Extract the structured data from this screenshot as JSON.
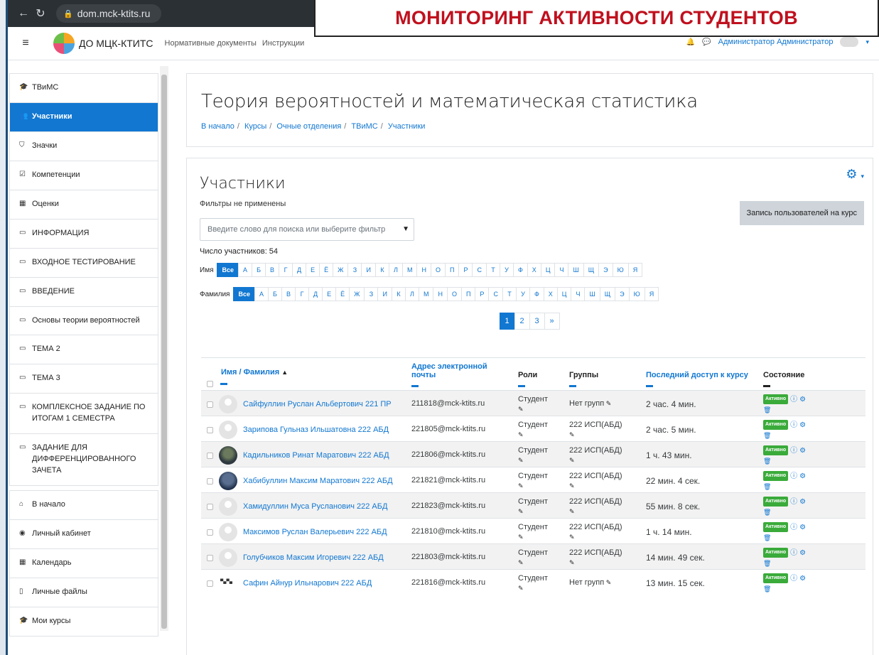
{
  "banner": {
    "title": "МОНИТОРИНГ АКТИВНОСТИ СТУДЕНТОВ"
  },
  "browser": {
    "url": "dom.mck-ktits.ru"
  },
  "navbar": {
    "site_name": "ДО МЦК-КТИТС",
    "links": [
      "Нормативные документы",
      "Инструкции"
    ],
    "user": "Администратор Администратор"
  },
  "sidebar": {
    "course_items": [
      {
        "icon": "graduation-cap-icon",
        "glyph": "🎓",
        "label": "ТВиМС"
      },
      {
        "icon": "users-icon",
        "glyph": "👥",
        "label": "Участники",
        "active": true
      },
      {
        "icon": "shield-icon",
        "glyph": "⛉",
        "label": "Значки"
      },
      {
        "icon": "check-square-icon",
        "glyph": "☑",
        "label": "Компетенции"
      },
      {
        "icon": "table-icon",
        "glyph": "▦",
        "label": "Оценки"
      },
      {
        "icon": "folder-icon",
        "glyph": "▭",
        "label": "ИНФОРМАЦИЯ"
      },
      {
        "icon": "folder-icon",
        "glyph": "▭",
        "label": "ВХОДНОЕ ТЕСТИРОВАНИЕ"
      },
      {
        "icon": "folder-icon",
        "glyph": "▭",
        "label": "ВВЕДЕНИЕ"
      },
      {
        "icon": "folder-icon",
        "glyph": "▭",
        "label": "Основы теории вероятностей"
      },
      {
        "icon": "folder-icon",
        "glyph": "▭",
        "label": "ТЕМА 2"
      },
      {
        "icon": "folder-icon",
        "glyph": "▭",
        "label": "ТЕМА 3"
      },
      {
        "icon": "folder-icon",
        "glyph": "▭",
        "label": "КОМПЛЕКСНОЕ ЗАДАНИЕ ПО ИТОГАМ 1 СЕМЕСТРА"
      },
      {
        "icon": "folder-icon",
        "glyph": "▭",
        "label": "ЗАДАНИЕ ДЛЯ ДИФФЕРЕНЦИРОВАННОГО ЗАЧЕТА"
      }
    ],
    "site_items": [
      {
        "icon": "home-icon",
        "glyph": "⌂",
        "label": "В начало"
      },
      {
        "icon": "dashboard-icon",
        "glyph": "◉",
        "label": "Личный кабинет"
      },
      {
        "icon": "calendar-icon",
        "glyph": "▦",
        "label": "Календарь"
      },
      {
        "icon": "file-icon",
        "glyph": "▯",
        "label": "Личные файлы"
      },
      {
        "icon": "graduation-cap-icon",
        "glyph": "🎓",
        "label": "Мои курсы"
      }
    ]
  },
  "header": {
    "title": "Теория вероятностей и математическая статистика",
    "breadcrumb": [
      "В начало",
      "Курсы",
      "Очные отделения",
      "ТВиМС",
      "Участники"
    ]
  },
  "participants": {
    "title": "Участники",
    "filters_note": "Фильтры не применены",
    "enrol_button": "Запись пользователей на курс",
    "search_placeholder": "Введите слово для поиска или выберите фильтр",
    "count": "Число участников: 54",
    "first_name_label": "Имя",
    "last_name_label": "Фамилия",
    "all_label": "Все",
    "letters": [
      "А",
      "Б",
      "В",
      "Г",
      "Д",
      "Е",
      "Ё",
      "Ж",
      "З",
      "И",
      "К",
      "Л",
      "М",
      "Н",
      "О",
      "П",
      "Р",
      "С",
      "Т",
      "У",
      "Ф",
      "Х",
      "Ц",
      "Ч",
      "Ш",
      "Щ",
      "Э",
      "Ю",
      "Я"
    ],
    "pages": [
      "1",
      "2",
      "3",
      "»"
    ],
    "columns": {
      "name": "Имя / Фамилия",
      "email": "Адрес электронной почты",
      "roles": "Роли",
      "groups": "Группы",
      "last_access": "Последний доступ к курсу",
      "status": "Состояние"
    },
    "status_badge": "Активно",
    "rows": [
      {
        "name": "Сайфуллин Руслан Альбертович 221 ПР",
        "avatar": "default",
        "email": "211818@mck-ktits.ru",
        "role": "Студент",
        "group": "Нет групп",
        "access": "2 час. 4 мин."
      },
      {
        "name": "Зарипова Гульназ Ильшатовна 222 АБД",
        "avatar": "default",
        "email": "221805@mck-ktits.ru",
        "role": "Студент",
        "group": "222 ИСП(АБД)",
        "access": "2 час. 5 мин."
      },
      {
        "name": "Кадильников Ринат Маратович 222 АБД",
        "avatar": "photo",
        "email": "221806@mck-ktits.ru",
        "role": "Студент",
        "group": "222 ИСП(АБД)",
        "access": "1 ч. 43 мин."
      },
      {
        "name": "Хабибуллин Максим Маратович 222 АБД",
        "avatar": "photo2",
        "email": "221821@mck-ktits.ru",
        "role": "Студент",
        "group": "222 ИСП(АБД)",
        "access": "22 мин. 4 сек."
      },
      {
        "name": "Хамидуллин Муса Русланович 222 АБД",
        "avatar": "default",
        "email": "221823@mck-ktits.ru",
        "role": "Студент",
        "group": "222 ИСП(АБД)",
        "access": "55 мин. 8 сек."
      },
      {
        "name": "Максимов Руслан Валерьевич 222 АБД",
        "avatar": "default",
        "email": "221810@mck-ktits.ru",
        "role": "Студент",
        "group": "222 ИСП(АБД)",
        "access": "1 ч. 14 мин."
      },
      {
        "name": "Голубчиков Максим Игоревич 222 АБД",
        "avatar": "default",
        "email": "221803@mck-ktits.ru",
        "role": "Студент",
        "group": "222 ИСП(АБД)",
        "access": "14 мин. 49 сек."
      },
      {
        "name": "Сафин Айнур Ильнарович 222 АБД",
        "avatar": "logo",
        "email": "221816@mck-ktits.ru",
        "role": "Студент",
        "group": "Нет групп",
        "access": "13 мин. 15 сек."
      }
    ]
  }
}
